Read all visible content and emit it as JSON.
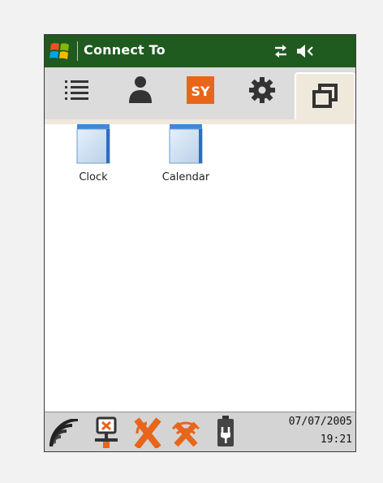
{
  "titlebar": {
    "title": "Connect To",
    "background_color": "#1f5a1f"
  },
  "tabs": [
    {
      "icon": "list-icon",
      "active": false
    },
    {
      "icon": "person-icon",
      "active": false
    },
    {
      "icon": "sy-logo-icon",
      "label": "SY",
      "color": "#e8651a",
      "active": false
    },
    {
      "icon": "gear-icon",
      "active": false
    },
    {
      "icon": "windows-icon",
      "active": true
    }
  ],
  "folders": [
    {
      "label": "Clock",
      "icon": "folder-icon"
    },
    {
      "label": "Calendar",
      "icon": "folder-icon"
    }
  ],
  "statusbar": {
    "date": "07/07/2005",
    "time": "19:21",
    "icons": [
      "signal-bars-icon",
      "network-disconnected-icon",
      "sync-error-icon",
      "wifi-disconnected-icon",
      "battery-plug-icon"
    ]
  }
}
